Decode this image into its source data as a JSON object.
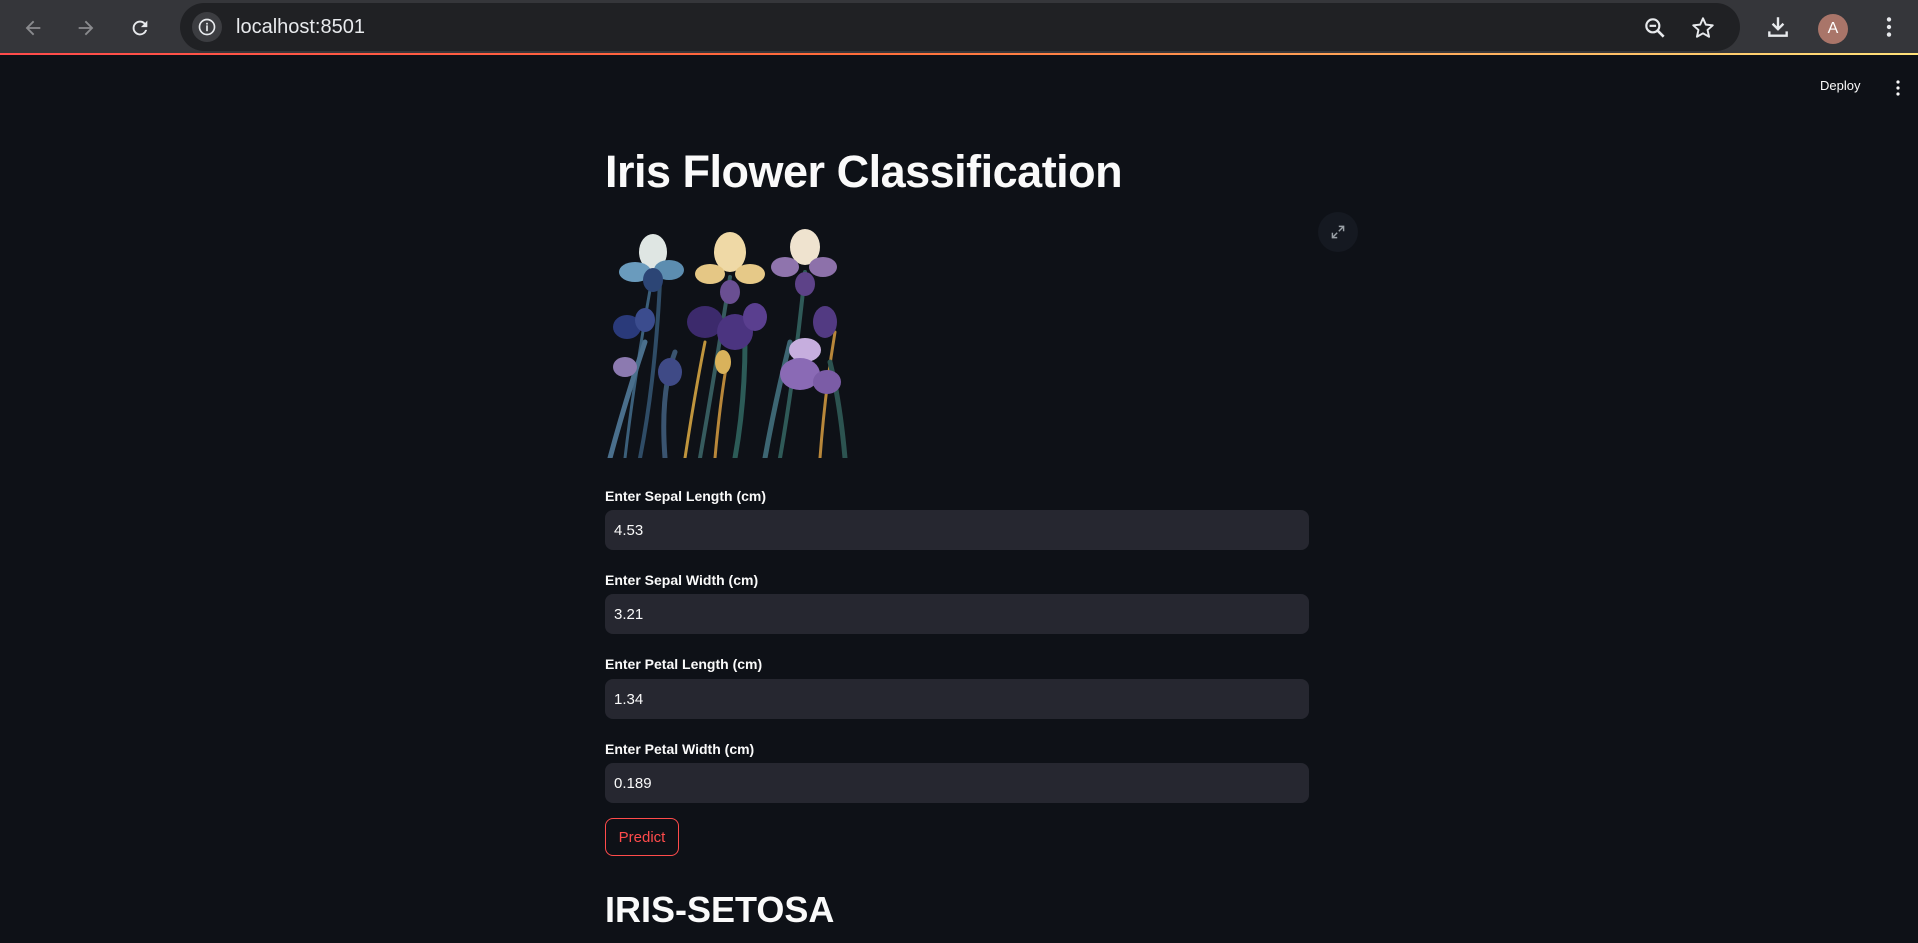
{
  "browser": {
    "url": "localhost:8501",
    "avatar_initial": "A",
    "icons": [
      "back-arrow-icon",
      "forward-arrow-icon",
      "reload-icon",
      "info-icon",
      "zoom-icon",
      "bookmark-star-icon",
      "download-icon",
      "kebab-menu-icon"
    ]
  },
  "header": {
    "deploy_label": "Deploy",
    "menu_icon": "kebab-menu-icon"
  },
  "main": {
    "title": "Iris Flower Classification",
    "image_icon": "iris-flowers-image",
    "fields": [
      {
        "label": "Enter Sepal Length (cm)",
        "value": "4.53"
      },
      {
        "label": "Enter Sepal Width (cm)",
        "value": "3.21"
      },
      {
        "label": "Enter Petal Length (cm)",
        "value": "1.34"
      },
      {
        "label": "Enter Petal Width (cm)",
        "value": "0.189"
      }
    ],
    "predict_label": "Predict",
    "result": "IRIS-SETOSA"
  },
  "colors": {
    "background": "#0e1117",
    "input_bg": "#262730",
    "accent": "#ff4b4b",
    "text": "#fafafa"
  }
}
